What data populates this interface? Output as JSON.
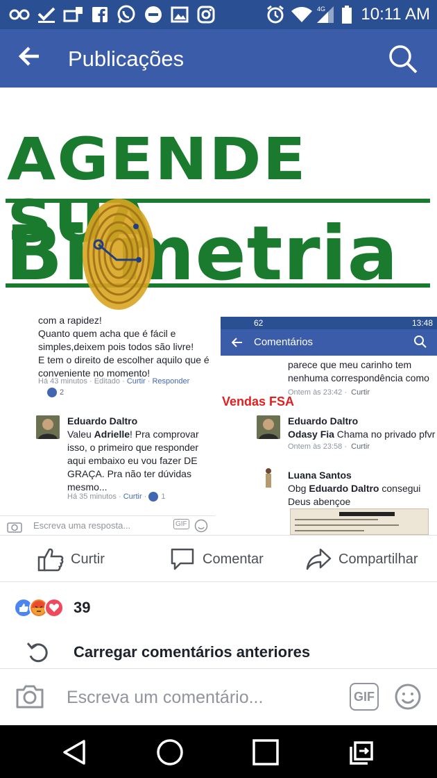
{
  "status_bar": {
    "time": "10:11 AM",
    "network": "4G",
    "icons": [
      "wear-icon",
      "check-icon",
      "mail-notification-icon",
      "facebook-icon",
      "whatsapp-icon",
      "minus-circle-icon",
      "image-icon",
      "instagram-icon",
      "alarm-icon",
      "wifi-icon",
      "signal-icon",
      "battery-icon"
    ]
  },
  "app_bar": {
    "title": "Publicações",
    "back_icon": "arrow-left-icon",
    "search_icon": "search-icon"
  },
  "post_image": {
    "banner_line1": "AGENDE SUA",
    "banner_line2": "Bi metria",
    "left_panel": {
      "comment_text": "com a rapidez!\nQuanto  quem acha que é fácil  e simples,deixem pois todos são  livre!\nE tem o direito de escolher aquilo que é conveniente no momento!",
      "comment_time": "Há 43 minutos",
      "comment_edited": "Editado",
      "comment_like": "Curtir",
      "comment_reply": "Responder",
      "comment_likes": "2",
      "reply_name": "Eduardo Daltro",
      "reply_text_pre": "Valeu ",
      "reply_mention": "Adrielle",
      "reply_text_post": "! Pra comprovar isso, o primeiro que responder aqui embaixo eu vou fazer DE GRAÇA. Pra não ter dúvidas mesmo...",
      "reply_time": "Há 35 minutos",
      "reply_like": "Curtir",
      "reply_likes": "1",
      "reply_placeholder": "Escreva uma resposta..."
    },
    "right_panel": {
      "status_count": "62",
      "status_time": "13:48",
      "title": "Comentários",
      "partial_text": "parece que meu carinho tem nenhuma correspondência como faço",
      "time1": "Ontem às 23:42",
      "like1": "Curtir",
      "overlay_label": "Vendas FSA",
      "c2_name": "Eduardo Daltro",
      "c2_mention": "Odasy Fia",
      "c2_text": " Chama no privado pfvr",
      "time2": "Ontem às 23:58",
      "like2": "Curtir",
      "c3_name": "Luana Santos",
      "c3_text_pre": "Obg ",
      "c3_mention": "Eduardo Daltro",
      "c3_text_post": " consegui Deus abençoe"
    }
  },
  "actions": {
    "like": "Curtir",
    "comment": "Comentar",
    "share": "Compartilhar"
  },
  "reactions": {
    "types": [
      "like-reaction-icon",
      "angry-reaction-icon",
      "love-reaction-icon"
    ],
    "count": "39"
  },
  "load_previous": "Carregar comentários anteriores",
  "composer": {
    "placeholder": "Escreva um comentário...",
    "gif_label": "GIF"
  },
  "colors": {
    "facebook_blue": "#3b5ca8",
    "status_blue": "#2b4f93",
    "banner_green": "#1a7a2e",
    "fingerprint_gold": "#d9a520"
  }
}
